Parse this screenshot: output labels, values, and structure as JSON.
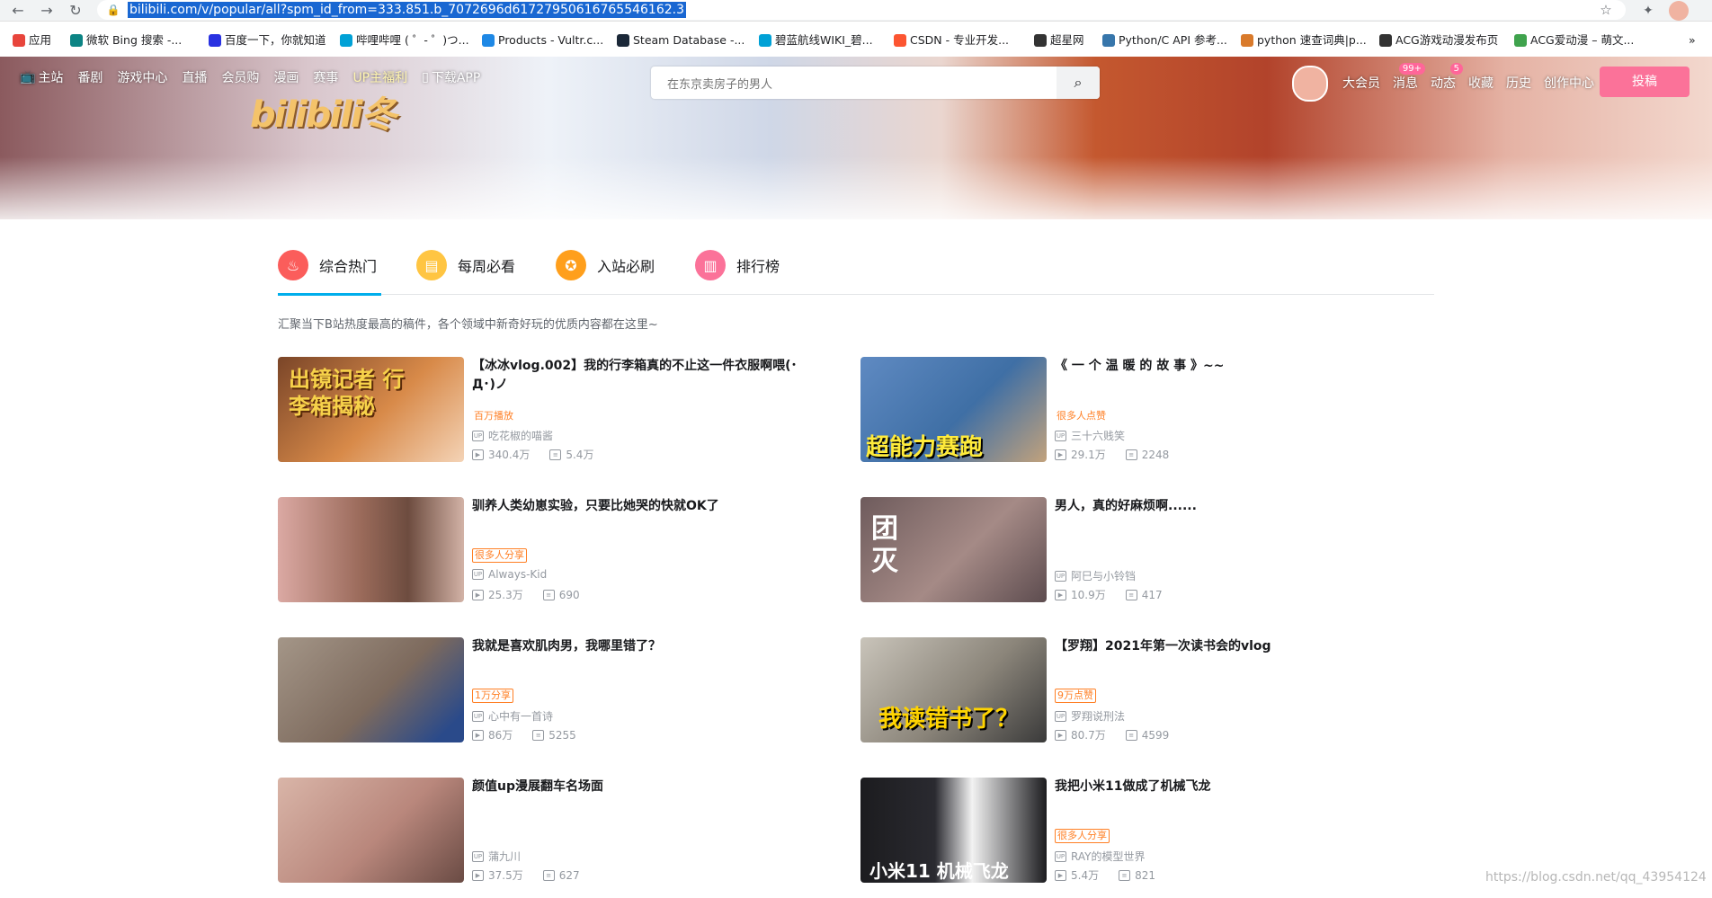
{
  "browser": {
    "url": "bilibili.com/v/popular/all?spm_id_from=333.851.b_7072696d61727950616765546162.3",
    "bookmarks": [
      {
        "label": "应用",
        "color": "#e8453c"
      },
      {
        "label": "微软 Bing 搜索 -...",
        "color": "#0c8484"
      },
      {
        "label": "百度一下，你就知道",
        "color": "#2932e1"
      },
      {
        "label": "哔哩哔哩 ( ゜- ゜)つ...",
        "color": "#00a1d6"
      },
      {
        "label": "Products - Vultr.c...",
        "color": "#1e88e5"
      },
      {
        "label": "Steam Database -...",
        "color": "#1b2838"
      },
      {
        "label": "碧蓝航线WIKI_碧...",
        "color": "#00a1d6"
      },
      {
        "label": "CSDN - 专业开发...",
        "color": "#fc5531"
      },
      {
        "label": "超星网",
        "color": "#333333"
      },
      {
        "label": "Python/C API 参考...",
        "color": "#3776ab"
      },
      {
        "label": "python 速查词典|p...",
        "color": "#d97a2b"
      },
      {
        "label": "ACG游戏动漫发布页",
        "color": "#333333"
      },
      {
        "label": "ACG爱动漫 – 萌文...",
        "color": "#3fa34d"
      }
    ]
  },
  "header": {
    "logo_text": "bilibili冬",
    "nav": [
      "主站",
      "番剧",
      "游戏中心",
      "直播",
      "会员购",
      "漫画",
      "赛事",
      "UP主福利",
      "下载APP"
    ],
    "search_placeholder": "在东京卖房子的男人",
    "right_nav": [
      {
        "label": "大会员",
        "badge": ""
      },
      {
        "label": "消息",
        "badge": "99+"
      },
      {
        "label": "动态",
        "badge": "5"
      },
      {
        "label": "收藏",
        "badge": ""
      },
      {
        "label": "历史",
        "badge": ""
      },
      {
        "label": "创作中心",
        "badge": ""
      }
    ],
    "upload_label": "投稿"
  },
  "tabs": [
    {
      "label": "综合热门",
      "color": "#fb5d5b",
      "icon": "flame-icon"
    },
    {
      "label": "每周必看",
      "color": "#ffc542",
      "icon": "calendar-icon"
    },
    {
      "label": "入站必刷",
      "color": "#ff9f1c",
      "icon": "medal-icon"
    },
    {
      "label": "排行榜",
      "color": "#fb7299",
      "icon": "ranking-icon"
    }
  ],
  "subtitle": "汇聚当下B站热度最高的稿件，各个领域中新奇好玩的优质内容都在这里~",
  "videos": [
    {
      "title": "【冰冰vlog.002】我的行李箱真的不止这一件衣服啊喂(･Д･)ノ",
      "tag": "百万播放",
      "tag_box": false,
      "up": "吃花椒的喵酱",
      "views": "340.4万",
      "danmaku": "5.4万",
      "thumb_text": "出镜记者 行李箱揭秘",
      "thumb_color": "#c9663a"
    },
    {
      "title": "《 一 个 温 暖 的 故 事 》~~",
      "tag": "很多人点赞",
      "tag_box": false,
      "up": "三十六贱笑",
      "views": "29.1万",
      "danmaku": "2248",
      "thumb_text": "超能力赛跑",
      "thumb_color": "#3f6fa5"
    },
    {
      "title": "驯养人类幼崽实验，只要比她哭的快就OK了",
      "tag": "很多人分享",
      "tag_box": true,
      "up": "Always-Kid",
      "views": "25.3万",
      "danmaku": "690",
      "thumb_text": "",
      "thumb_color": "#c59c93"
    },
    {
      "title": "男人，真的好麻烦啊......",
      "tag": "",
      "tag_box": false,
      "up": "阿巳与小铃铛",
      "views": "10.9万",
      "danmaku": "417",
      "thumb_text": "团灭",
      "thumb_color": "#7b6566"
    },
    {
      "title": "我就是喜欢肌肉男，我哪里错了？",
      "tag": "1万分享",
      "tag_box": true,
      "up": "心中有一首诗",
      "views": "86万",
      "danmaku": "5255",
      "thumb_text": "",
      "thumb_color": "#8b8076"
    },
    {
      "title": "【罗翔】2021年第一次读书会的vlog",
      "tag": "9万点赞",
      "tag_box": true,
      "up": "罗翔说刑法",
      "views": "80.7万",
      "danmaku": "4599",
      "thumb_text": "我读错书了？",
      "thumb_color": "#a7a39a"
    },
    {
      "title": "颜值up漫展翻车名场面",
      "tag": "",
      "tag_box": false,
      "up": "蒲九川",
      "views": "37.5万",
      "danmaku": "627",
      "thumb_text": "",
      "thumb_color": "#b9877c"
    },
    {
      "title": "我把小米11做成了机械飞龙",
      "tag": "很多人分享",
      "tag_box": true,
      "up": "RAY的模型世界",
      "views": "5.4万",
      "danmaku": "821",
      "thumb_text": "小米11 机械飞龙",
      "thumb_color": "#1c1c1f"
    }
  ],
  "watermark": "https://blog.csdn.net/qq_43954124"
}
